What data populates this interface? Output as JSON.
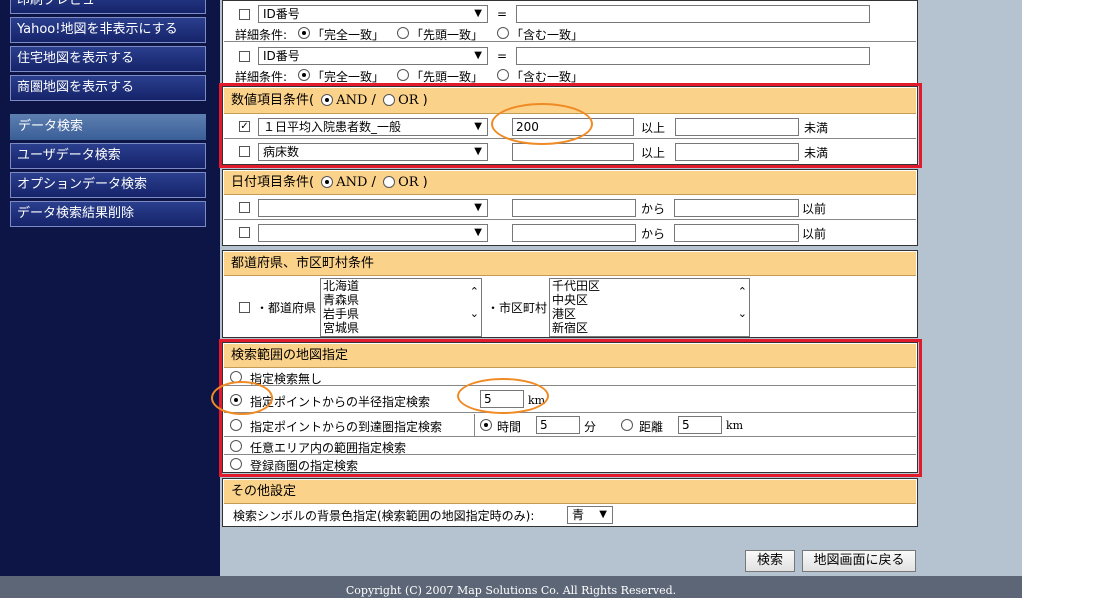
{
  "sidebar": {
    "items": [
      {
        "label": "印刷プレビュー"
      },
      {
        "label": "Yahoo!地図を非表示にする"
      },
      {
        "label": "住宅地図を表示する"
      },
      {
        "label": "商圏地図を表示する"
      }
    ],
    "section_header": "データ検索",
    "search_items": [
      {
        "label": "ユーザデータ検索"
      },
      {
        "label": "オプションデータ検索"
      },
      {
        "label": "データ検索結果削除"
      }
    ]
  },
  "text_conditions": {
    "rows": [
      {
        "field": "ID番号",
        "equals": "=",
        "value": "",
        "detail_label": "詳細条件:",
        "opt1": "「完全一致」",
        "opt2": "「先頭一致」",
        "opt3": "「含む一致」"
      },
      {
        "field": "ID番号",
        "equals": "=",
        "value": "",
        "detail_label": "詳細条件:",
        "opt1": "「完全一致」",
        "opt2": "「先頭一致」",
        "opt3": "「含む一致」"
      }
    ]
  },
  "numeric": {
    "header": "数値項目条件(",
    "and": "AND",
    "slash": "/",
    "or": "OR",
    "close": ")",
    "rows": [
      {
        "checked": "✓",
        "field": "１日平均入院患者数_一般",
        "value": "200",
        "gte": "以上",
        "max": "",
        "lt": "未満"
      },
      {
        "checked": "",
        "field": "病床数",
        "value": "",
        "gte": "以上",
        "max": "",
        "lt": "未満"
      }
    ]
  },
  "date": {
    "header": "日付項目条件(",
    "and": "AND",
    "slash": "/",
    "or": "OR",
    "close": ")",
    "rows": [
      {
        "field": "",
        "from": "",
        "from_label": "から",
        "to": "",
        "before": "以前"
      },
      {
        "field": "",
        "from": "",
        "from_label": "から",
        "to": "",
        "before": "以前"
      }
    ]
  },
  "region": {
    "header": "都道府県、市区町村条件",
    "pref_label": "・都道府県",
    "prefs": [
      "北海道",
      "青森県",
      "岩手県",
      "宮城県"
    ],
    "city_label": "・市区町村",
    "cities": [
      "千代田区",
      "中央区",
      "港区",
      "新宿区"
    ]
  },
  "map_range": {
    "header": "検索範囲の地図指定",
    "opt_none": "指定検索無し",
    "opt_radius": "指定ポイントからの半径指定検索",
    "radius_value": "5",
    "radius_unit": "km",
    "opt_reach": "指定ポイントからの到達圏指定検索",
    "time_label": "時間",
    "time_value": "5",
    "time_unit": "分",
    "dist_label": "距離",
    "dist_value": "5",
    "dist_unit": "km",
    "opt_area": "任意エリア内の範囲指定検索",
    "opt_trade": "登録商圏の指定検索"
  },
  "other": {
    "header": "その他設定",
    "bg_label": "検索シンボルの背景色指定(検索範囲の地図指定時のみ):",
    "bg_value": "青"
  },
  "buttons": {
    "search": "検索",
    "back": "地図画面に戻る"
  },
  "footer": "Copyright (C) 2007 Map Solutions Co.   All Rights Reserved.",
  "colors": {
    "highlight_box": "#e21b2c",
    "annotation_oval": "#f08a24",
    "header_bg": "#fbd28a",
    "sidebar_bg": "#0d1547"
  }
}
